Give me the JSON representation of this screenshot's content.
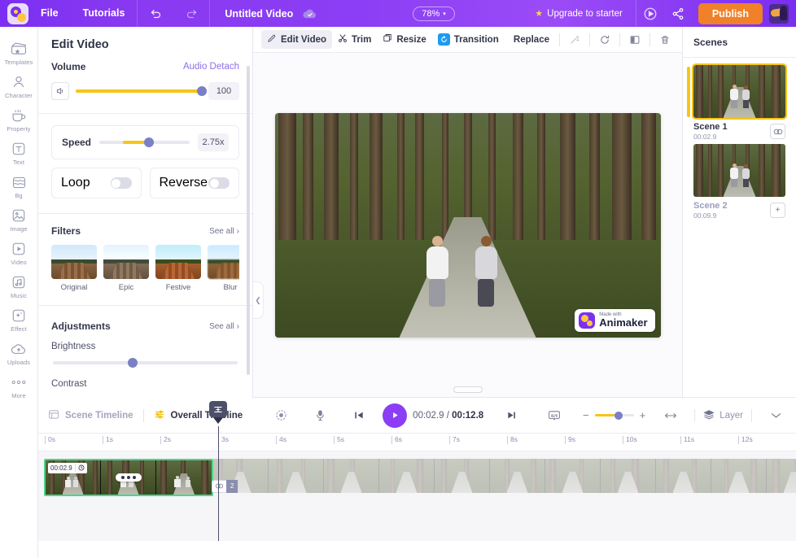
{
  "topbar": {
    "logo": "animaker-logo",
    "menu": [
      "File",
      "Tutorials"
    ],
    "undo_icon": "undo-icon",
    "redo_icon": "redo-icon",
    "project_title": "Untitled Video",
    "cloud_icon": "cloud-saved-icon",
    "zoom_level": "78%",
    "zoom_caret": "▾",
    "upgrade_label": "Upgrade to starter",
    "star": "★",
    "preview_icon": "preview-play-icon",
    "share_icon": "share-icon",
    "publish_label": "Publish",
    "avatar": "user-avatar"
  },
  "rail": {
    "items": [
      {
        "label": "Templates",
        "icon": "templates-icon"
      },
      {
        "label": "Character",
        "icon": "character-icon"
      },
      {
        "label": "Property",
        "icon": "property-icon"
      },
      {
        "label": "Text",
        "icon": "text-icon"
      },
      {
        "label": "Bg",
        "icon": "background-icon"
      },
      {
        "label": "Image",
        "icon": "image-icon"
      },
      {
        "label": "Video",
        "icon": "video-icon"
      },
      {
        "label": "Music",
        "icon": "music-icon"
      },
      {
        "label": "Effect",
        "icon": "effect-icon"
      },
      {
        "label": "Uploads",
        "icon": "uploads-icon"
      },
      {
        "label": "More",
        "icon": "more-icon"
      }
    ]
  },
  "panel": {
    "title": "Edit Video",
    "volume_label": "Volume",
    "audio_detach_label": "Audio Detach",
    "volume_value": "100",
    "volume_percent": 100,
    "speed_label": "Speed",
    "speed_value": "2.75x",
    "speed_percent": 55,
    "loop_label": "Loop",
    "loop_on": false,
    "reverse_label": "Reverse",
    "reverse_on": false,
    "filters_label": "Filters",
    "see_all_label": "See all",
    "filters": [
      {
        "name": "Original"
      },
      {
        "name": "Epic"
      },
      {
        "name": "Festive"
      },
      {
        "name": "Blur"
      }
    ],
    "adjustments_label": "Adjustments",
    "brightness_label": "Brightness",
    "brightness_percent": 43,
    "contrast_label": "Contrast"
  },
  "stage": {
    "tools": [
      {
        "label": "Edit Video",
        "icon": "pencil-icon",
        "active": true
      },
      {
        "label": "Trim",
        "icon": "scissors-icon",
        "active": false
      },
      {
        "label": "Resize",
        "icon": "resize-icon",
        "active": false
      },
      {
        "label": "Transition",
        "icon": "transition-icon",
        "active": false
      }
    ],
    "replace_label": "Replace",
    "right_icons": [
      {
        "name": "magic-wand-icon"
      },
      {
        "name": "rotate-icon"
      },
      {
        "name": "flip-icon"
      },
      {
        "name": "delete-icon"
      }
    ],
    "collapse_icon": "chevron-left-icon",
    "watermark_small": "Made with",
    "watermark_brand": "Animaker"
  },
  "scenes": {
    "title": "Scenes",
    "items": [
      {
        "name": "Scene 1",
        "duration": "00:02.9",
        "selected": true,
        "action_icon": "duplicate-icon"
      },
      {
        "name": "Scene 2",
        "duration": "00:09.9",
        "selected": false,
        "action_icon": "add-icon"
      }
    ]
  },
  "timeline": {
    "scene_timeline_label": "Scene Timeline",
    "scene_timeline_icon": "scene-timeline-icon",
    "overall_timeline_label": "Overall Timeline",
    "overall_timeline_icon": "overall-timeline-icon",
    "fit_icon": "fit-to-screen-icon",
    "mic_icon": "microphone-icon",
    "prev_icon": "skip-back-icon",
    "play_icon": "play-icon",
    "current_time": "00:02.9",
    "separator": "/",
    "total_time": "00:12.8",
    "next_icon": "skip-forward-icon",
    "subtitle_icon": "subtitle-icon",
    "zoom_minus": "−",
    "zoom_plus": "+",
    "fit_width_icon": "fit-width-icon",
    "layer_label": "Layer",
    "layer_icon": "layers-icon",
    "expand_icon": "chevron-down-icon",
    "ruler_ticks": [
      "0s",
      "1s",
      "2s",
      "3s",
      "4s",
      "5s",
      "6s",
      "7s",
      "8s",
      "9s",
      "10s",
      "11s",
      "12s"
    ],
    "playhead_time": "3s",
    "clip": {
      "duration_badge": "00:02.9",
      "clock_icon": "clock-icon",
      "options_icon": "more-options-icon",
      "link_icon": "link-icon",
      "link_count": "2"
    }
  }
}
